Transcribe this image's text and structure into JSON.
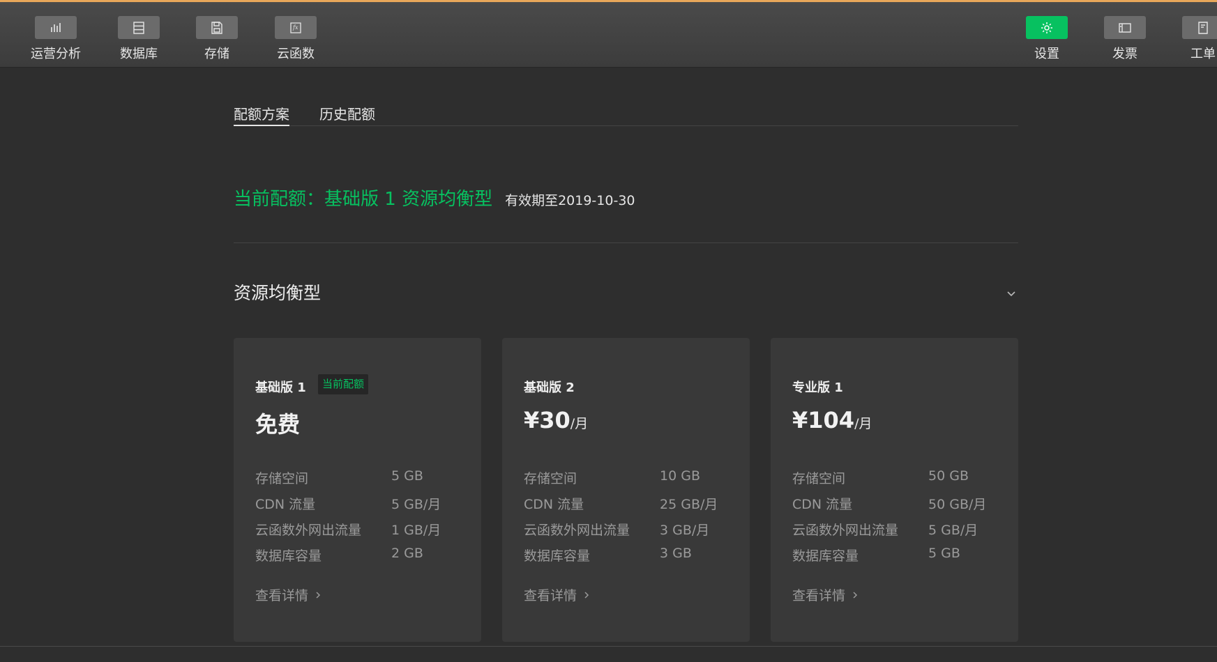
{
  "toolbar": {
    "left": [
      {
        "label": "运营分析",
        "icon": "bar-chart-icon"
      },
      {
        "label": "数据库",
        "icon": "database-icon"
      },
      {
        "label": "存储",
        "icon": "save-icon"
      },
      {
        "label": "云函数",
        "icon": "function-icon"
      }
    ],
    "right": [
      {
        "label": "设置",
        "icon": "gear-icon"
      },
      {
        "label": "发票",
        "icon": "invoice-icon"
      },
      {
        "label": "工单",
        "icon": "ticket-icon"
      }
    ]
  },
  "tabs": [
    {
      "label": "配额方案",
      "active": true
    },
    {
      "label": "历史配额",
      "active": false
    }
  ],
  "quota": {
    "current": "当前配额：基础版 1 资源均衡型",
    "valid_until": "有效期至2019-10-30"
  },
  "section": {
    "title": "资源均衡型"
  },
  "plans": [
    {
      "name": "基础版 1",
      "badge": "当前配额",
      "price": "免费",
      "unit": "",
      "specs": [
        {
          "k": "存储空间",
          "v": "5 GB"
        },
        {
          "k": "CDN 流量",
          "v": "5 GB/月"
        },
        {
          "k": "云函数外网出流量",
          "v": "1 GB/月"
        },
        {
          "k": "数据库容量",
          "v": "2 GB"
        }
      ],
      "detail": "查看详情"
    },
    {
      "name": "基础版 2",
      "badge": "",
      "price": "¥30",
      "unit": "/月",
      "specs": [
        {
          "k": "存储空间",
          "v": "10 GB"
        },
        {
          "k": "CDN 流量",
          "v": "25 GB/月"
        },
        {
          "k": "云函数外网出流量",
          "v": "3 GB/月"
        },
        {
          "k": "数据库容量",
          "v": "3 GB"
        }
      ],
      "detail": "查看详情"
    },
    {
      "name": "专业版 1",
      "badge": "",
      "price": "¥104",
      "unit": "/月",
      "specs": [
        {
          "k": "存储空间",
          "v": "50 GB"
        },
        {
          "k": "CDN 流量",
          "v": "50 GB/月"
        },
        {
          "k": "云函数外网出流量",
          "v": "5 GB/月"
        },
        {
          "k": "数据库容量",
          "v": "5 GB"
        }
      ],
      "detail": "查看详情"
    }
  ],
  "colors": {
    "accent": "#07c160",
    "topbar_border": "#e8a75a",
    "background": "#2e2e2e",
    "card": "#393939"
  }
}
